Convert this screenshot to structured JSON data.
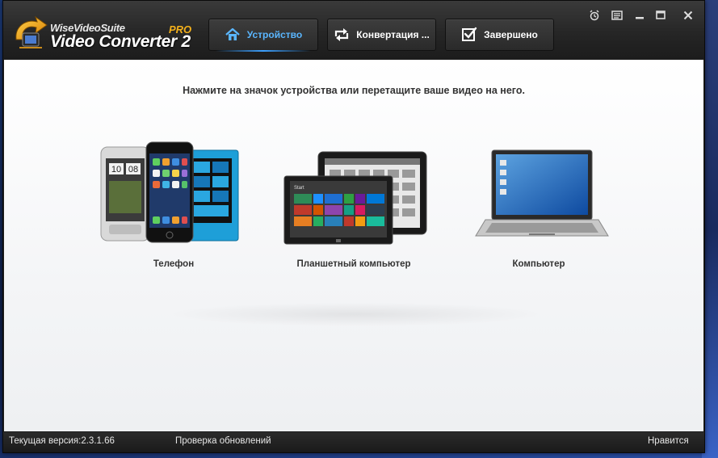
{
  "brand": {
    "name_small": "WiseVideoSuite",
    "name_big": "Video Converter 2",
    "edition": "PRO"
  },
  "tabs": [
    {
      "label": "Устройство",
      "icon": "home-icon",
      "active": true
    },
    {
      "label": "Конвертация ...",
      "icon": "convert-arrows-icon",
      "active": false
    },
    {
      "label": "Завершено",
      "icon": "checkbox-icon",
      "active": false
    }
  ],
  "window_controls": [
    "alarm-icon",
    "menu-icon",
    "minimize-icon",
    "maximize-icon",
    "close-icon"
  ],
  "main": {
    "instruction": "Нажмите на значок устройства или перетащите ваше видео на него.",
    "devices": [
      {
        "label": "Телефон",
        "icon": "phones-icon"
      },
      {
        "label": "Планшетный компьютер",
        "icon": "tablets-icon"
      },
      {
        "label": "Компьютер",
        "icon": "laptop-icon"
      }
    ],
    "tablet_screen_text": "Start"
  },
  "phone_clock": {
    "hours": "10",
    "minutes": "08"
  },
  "footer": {
    "version": "Текущая версия:2.3.1.66",
    "check_updates": "Проверка обновлений",
    "like": "Нравится"
  },
  "colors": {
    "accent_blue": "#5ab6ff",
    "pro_orange": "#f3b01b",
    "header_dark": "#262626"
  }
}
